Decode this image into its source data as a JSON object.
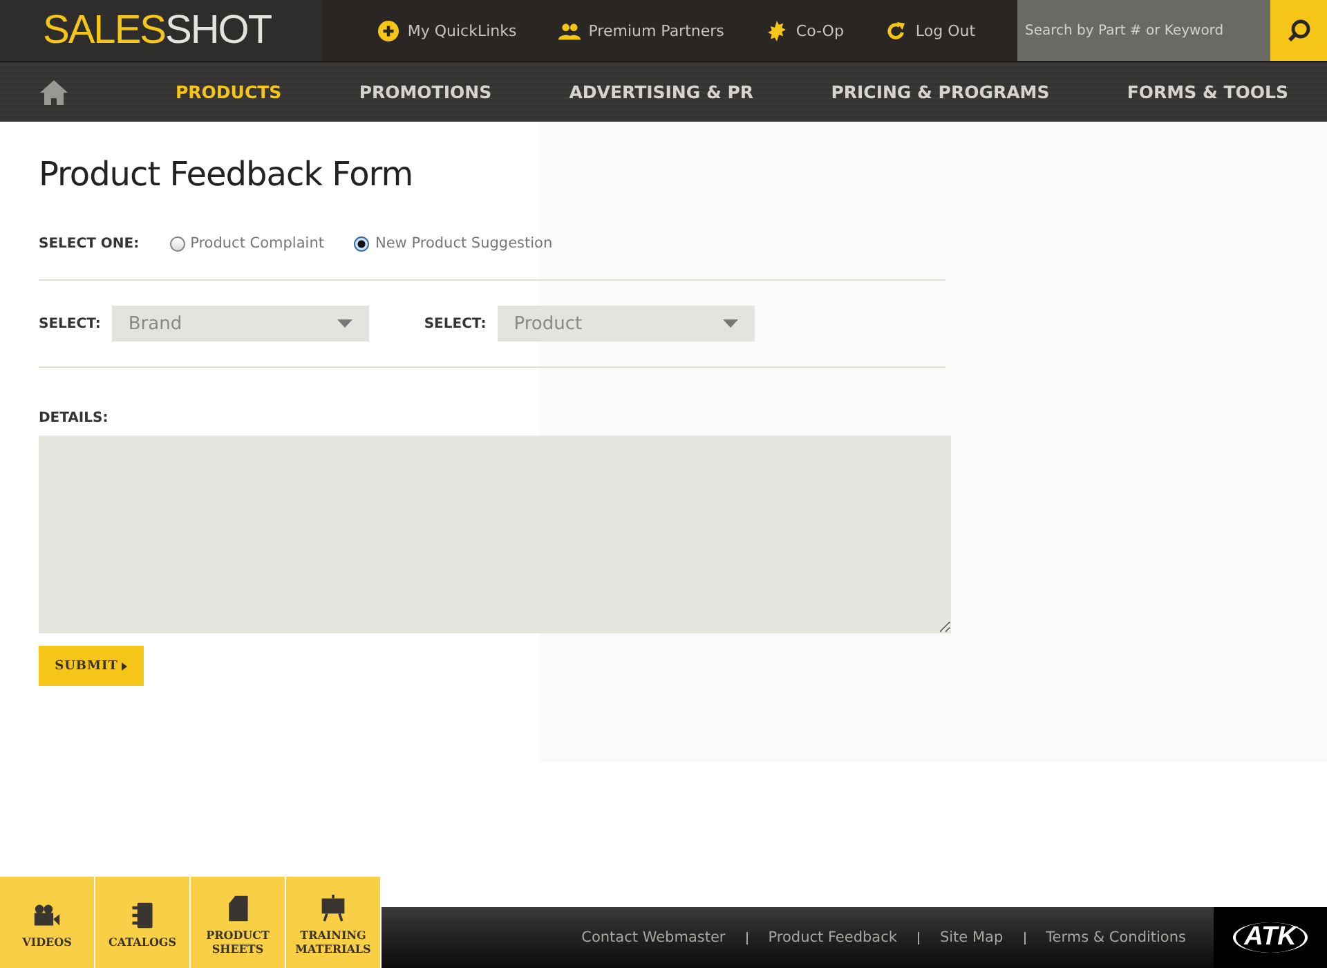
{
  "header": {
    "logo": {
      "part_1": "SALES",
      "part_2": "SHOT"
    },
    "quick_links": [
      {
        "label": "My QuickLinks"
      },
      {
        "label": "Premium Partners"
      },
      {
        "label": "Co-Op"
      },
      {
        "label": "Log Out"
      }
    ],
    "search": {
      "placeholder": "Search by Part # or Keyword"
    }
  },
  "nav": {
    "items": [
      {
        "label": "PRODUCTS",
        "selected": true
      },
      {
        "label": "PROMOTIONS",
        "selected": false
      },
      {
        "label": "ADVERTISING & PR",
        "selected": false
      },
      {
        "label": "PRICING & PROGRAMS",
        "selected": false
      },
      {
        "label": "FORMS & TOOLS",
        "selected": false
      }
    ]
  },
  "form": {
    "title": "Product Feedback Form",
    "select_one_label": "SELECT ONE:",
    "options": [
      {
        "label": "Product Complaint",
        "selected": false
      },
      {
        "label": "New Product Suggestion",
        "selected": true
      }
    ],
    "selects": [
      {
        "label": "SELECT:",
        "value": "Brand"
      },
      {
        "label": "SELECT:",
        "value": "Product"
      }
    ],
    "details_label": "DETAILS:",
    "submit": "SUBMIT"
  },
  "footer": {
    "tiles": [
      {
        "label": "VIDEOS"
      },
      {
        "label": "CATALOGS"
      },
      {
        "label": "PRODUCT SHEETS"
      },
      {
        "label": "TRAINING MATERIALS"
      }
    ],
    "links": [
      "Contact Webmaster",
      "Product Feedback",
      "Site Map",
      "Terms & Conditions"
    ],
    "logo": "ATK"
  }
}
